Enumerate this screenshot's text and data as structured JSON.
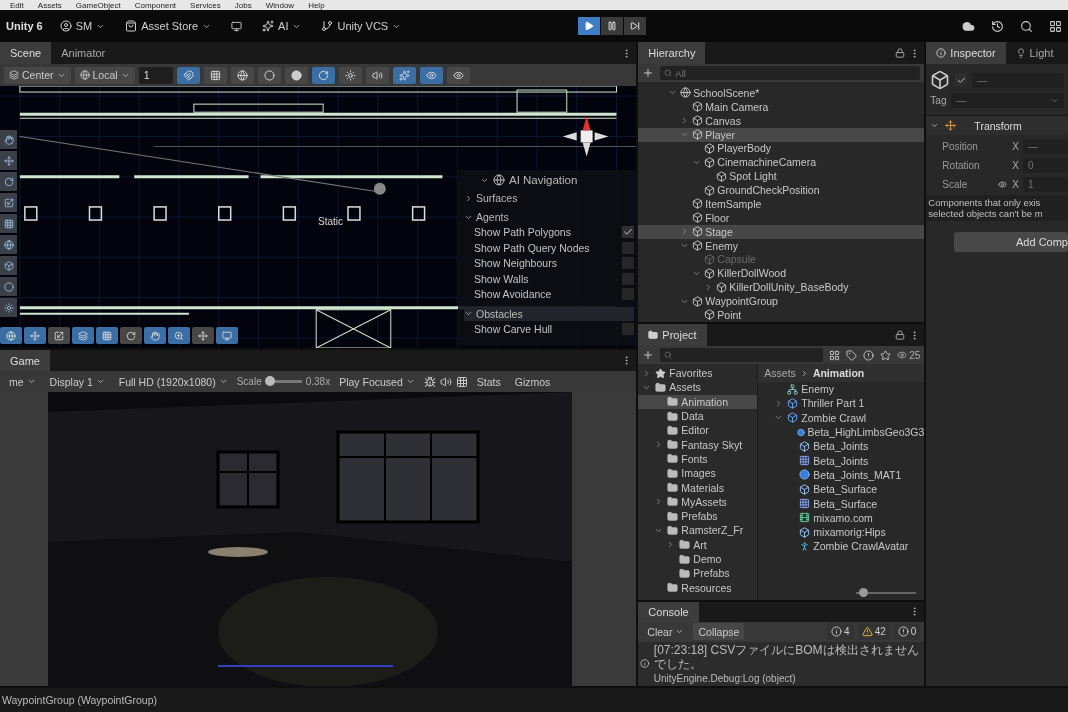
{
  "menu_bar": [
    "Edit",
    "Assets",
    "GameObject",
    "Component",
    "Services",
    "Jobs",
    "Window",
    "Help"
  ],
  "toolbar": {
    "product": "Unity 6",
    "items": [
      {
        "label": "SM",
        "kind": "account"
      },
      {
        "label": "Asset Store",
        "kind": "store"
      },
      {
        "label": "AI",
        "kind": "ai"
      },
      {
        "label": "Unity VCS",
        "kind": "vcs"
      }
    ],
    "playback": [
      {
        "kind": "play",
        "selected": true
      },
      {
        "kind": "pause",
        "selected": false
      },
      {
        "kind": "step",
        "selected": false
      }
    ]
  },
  "scene": {
    "tabs": [
      {
        "label": "Scene",
        "selected": true
      },
      {
        "label": "Animator",
        "selected": false
      }
    ],
    "pivot": "Center",
    "space": "Local",
    "grid_size": "1",
    "static_label": "Static",
    "ai_navigation": {
      "title": "AI Navigation",
      "sections": [
        {
          "label": "Surfaces",
          "expanded": false
        },
        {
          "label": "Agents",
          "expanded": true,
          "options": [
            {
              "label": "Show Path Polygons",
              "checked": true
            },
            {
              "label": "Show Path Query Nodes",
              "checked": false
            },
            {
              "label": "Show Neighbours",
              "checked": false
            },
            {
              "label": "Show Walls",
              "checked": false
            },
            {
              "label": "Show Avoidance",
              "checked": false
            }
          ]
        },
        {
          "label": "Obstacles",
          "expanded": true,
          "options": [
            {
              "label": "Show Carve Hull",
              "checked": false
            }
          ]
        }
      ]
    }
  },
  "game": {
    "tab": "Game",
    "view": "me",
    "display": "Display 1",
    "resolution": "Full HD (1920x1080)",
    "scale_label": "Scale",
    "scale": {
      "level": 0.12
    },
    "scale_reading": "0.38x",
    "play_mode": "Play Focused",
    "stats": "Stats",
    "gizmos": "Gizmos"
  },
  "hierarchy": {
    "tab": "Hierarchy",
    "placeholder": "All",
    "tree": [
      {
        "label": "SchoolScene*",
        "expanded": true,
        "selected": false,
        "disabled": false,
        "children": [
          {
            "label": "Main Camera",
            "selected": false,
            "disabled": false
          },
          {
            "label": "Canvas",
            "expanded": false,
            "selected": false,
            "disabled": false
          },
          {
            "label": "Player",
            "expanded": true,
            "selected": true,
            "disabled": false,
            "children": [
              {
                "label": "PlayerBody",
                "selected": false,
                "disabled": false
              },
              {
                "label": "CinemachineCamera",
                "expanded": true,
                "selected": false,
                "disabled": false,
                "children": [
                  {
                    "label": "Spot Light",
                    "selected": false,
                    "disabled": false
                  }
                ]
              },
              {
                "label": "GroundCheckPosition",
                "selected": false,
                "disabled": false
              }
            ]
          },
          {
            "label": "ItemSample",
            "selected": false,
            "disabled": false
          },
          {
            "label": "Floor",
            "selected": false,
            "disabled": false
          },
          {
            "label": "Stage",
            "expanded": false,
            "selected": true,
            "disabled": false
          },
          {
            "label": "Enemy",
            "expanded": true,
            "selected": false,
            "disabled": false,
            "children": [
              {
                "label": "Capsule",
                "selected": false,
                "disabled": true
              },
              {
                "label": "KillerDollWood",
                "expanded": true,
                "selected": false,
                "disabled": false,
                "children": [
                  {
                    "label": "KillerDollUnity_BaseBody",
                    "expanded": false,
                    "selected": false,
                    "disabled": false
                  }
                ]
              }
            ]
          },
          {
            "label": "WaypointGroup",
            "expanded": true,
            "selected": false,
            "disabled": false,
            "children": [
              {
                "label": "Point",
                "selected": false,
                "disabled": false
              }
            ]
          }
        ]
      }
    ]
  },
  "project": {
    "tab": "Project",
    "badge": "25",
    "tree": [
      {
        "label": "Favorites",
        "kind": "favorites",
        "expanded": false,
        "selected": false
      },
      {
        "label": "Assets",
        "kind": "folder",
        "expanded": true,
        "selected": false,
        "children": [
          {
            "label": "Animation",
            "kind": "folder",
            "selected": true
          },
          {
            "label": "Data",
            "kind": "folder",
            "selected": false
          },
          {
            "label": "Editor",
            "kind": "folder",
            "selected": false
          },
          {
            "label": "Fantasy Skyt",
            "kind": "folder",
            "expanded": false,
            "selected": false
          },
          {
            "label": "Fonts",
            "kind": "folder",
            "selected": false
          },
          {
            "label": "Images",
            "kind": "folder",
            "selected": false
          },
          {
            "label": "Materials",
            "kind": "folder",
            "selected": false
          },
          {
            "label": "MyAssets",
            "kind": "folder",
            "expanded": false,
            "selected": false
          },
          {
            "label": "Prefabs",
            "kind": "folder",
            "selected": false
          },
          {
            "label": "RamsterZ_Fr",
            "kind": "folder",
            "expanded": true,
            "selected": false,
            "children": [
              {
                "label": "Art",
                "kind": "folder",
                "expanded": false,
                "selected": false
              },
              {
                "label": "Demo",
                "kind": "folder",
                "selected": false
              },
              {
                "label": "Prefabs",
                "kind": "folder",
                "selected": false
              }
            ]
          },
          {
            "label": "Resources",
            "kind": "folder",
            "selected": false
          }
        ]
      }
    ],
    "breadcrumb": [
      "Assets",
      "Animation"
    ],
    "assets": [
      {
        "label": "Enemy",
        "kind": "controller"
      },
      {
        "label": "Thriller Part 1",
        "kind": "model",
        "expanded": false
      },
      {
        "label": "Zombie Crawl",
        "kind": "model",
        "expanded": true,
        "children": [
          {
            "label": "Beta_HighLimbsGeo3G3",
            "kind": "material"
          },
          {
            "label": "Beta_Joints",
            "kind": "mesh"
          },
          {
            "label": "Beta_Joints",
            "kind": "grid"
          },
          {
            "label": "Beta_Joints_MAT1",
            "kind": "material"
          },
          {
            "label": "Beta_Surface",
            "kind": "mesh"
          },
          {
            "label": "Beta_Surface",
            "kind": "grid"
          },
          {
            "label": "mixamo.com",
            "kind": "clip"
          },
          {
            "label": "mixamorig:Hips",
            "kind": "mesh"
          },
          {
            "label": "Zombie CrawlAvatar",
            "kind": "avatar"
          }
        ]
      }
    ],
    "zoom": {
      "level": 0.05
    }
  },
  "console": {
    "tab": "Console",
    "clear": "Clear",
    "collapse": "Collapse",
    "counts": [
      {
        "kind": "info",
        "count": "4"
      },
      {
        "kind": "warning",
        "count": "42"
      },
      {
        "kind": "error",
        "count": "0"
      }
    ],
    "messages": [
      {
        "kind": "info",
        "text": "[07:23:18] CSVファイルにBOMは検出されませんでした。",
        "detail": "UnityEngine.Debug:Log (object)"
      }
    ]
  },
  "inspector": {
    "tabs": [
      {
        "label": "Inspector",
        "kind": "info",
        "selected": true
      },
      {
        "label": "Light",
        "kind": "light",
        "selected": false
      }
    ],
    "active": true,
    "name": "—",
    "tag_label": "Tag",
    "tag": "—",
    "component": {
      "title": "Transform",
      "expanded": true,
      "fields": [
        {
          "label": "Position",
          "axis": "X",
          "value": "—",
          "linked": false
        },
        {
          "label": "Rotation",
          "axis": "X",
          "value": "0",
          "linked": false
        },
        {
          "label": "Scale",
          "axis": "X",
          "value": "1",
          "linked": true
        }
      ]
    },
    "notice": [
      "Components that only exis",
      "selected objects can't be m"
    ],
    "add_button": "Add Comp"
  },
  "status_bar": {
    "message": "WaypointGroup (WaypointGroup)"
  }
}
